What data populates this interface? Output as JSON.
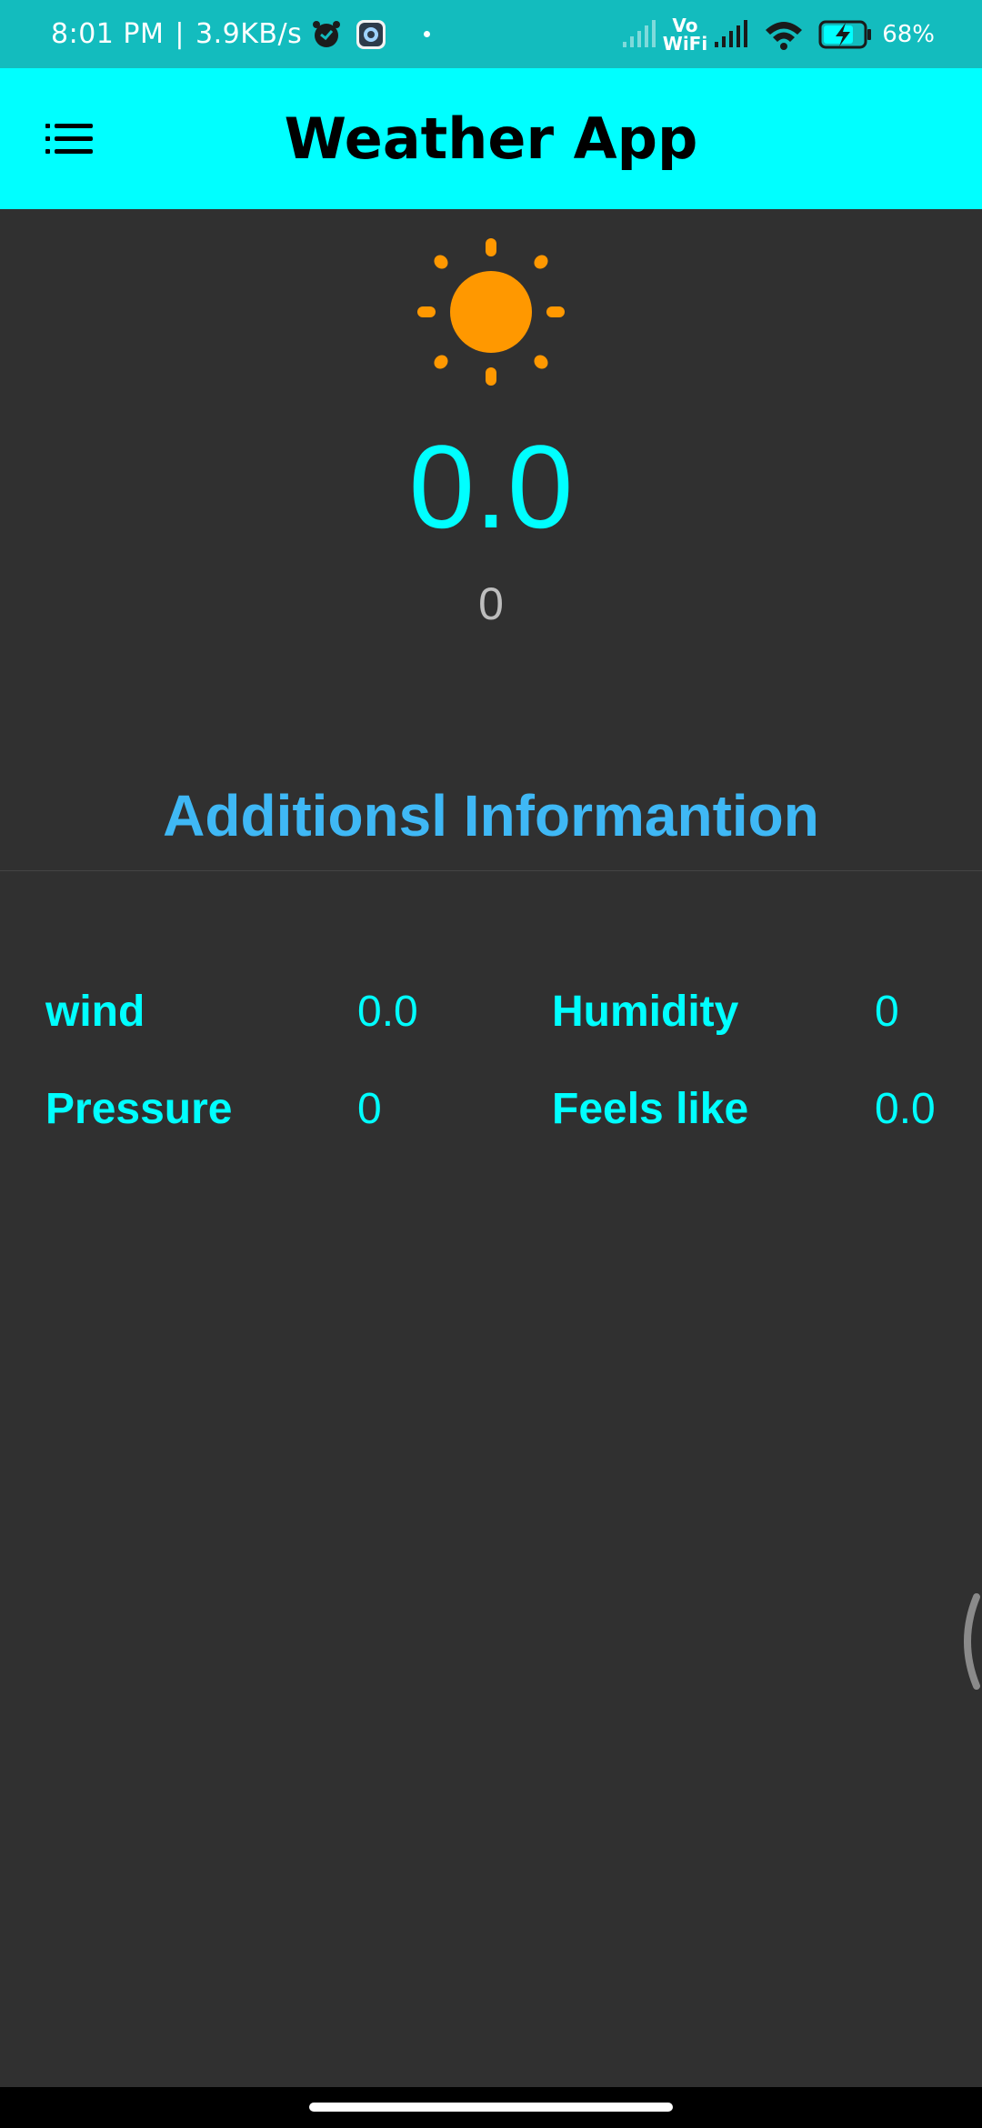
{
  "status_bar": {
    "time": "8:01 PM",
    "separator": "|",
    "network_speed": "3.9KB/s",
    "vowifi_top": "Vo",
    "vowifi_bottom": "WiFi",
    "battery": "68%",
    "icons": [
      "alarm-icon",
      "settings-app-icon",
      "notification-dot-icon",
      "signal-icon",
      "wifi-icon",
      "battery-charging-icon"
    ]
  },
  "app_bar": {
    "title": "Weather App",
    "menu_icon": "menu-icon"
  },
  "weather": {
    "icon": "sun-icon",
    "temperature": "0.0",
    "description": "0"
  },
  "additional_info": {
    "title": "Additionsl Informantion",
    "wind_label": "wind",
    "wind_value": "0.0",
    "humidity_label": "Humidity",
    "humidity_value": "0",
    "pressure_label": "Pressure",
    "pressure_value": "0",
    "feels_like_label": "Feels like",
    "feels_like_value": "0.0"
  },
  "colors": {
    "status_bar": "#13BCBE",
    "app_bar": "#00FFFF",
    "background": "#303030",
    "accent_cyan": "#00FFFF",
    "section_title": "#3FB8F5",
    "sun": "#FF9800",
    "description": "#BDBDBD"
  }
}
